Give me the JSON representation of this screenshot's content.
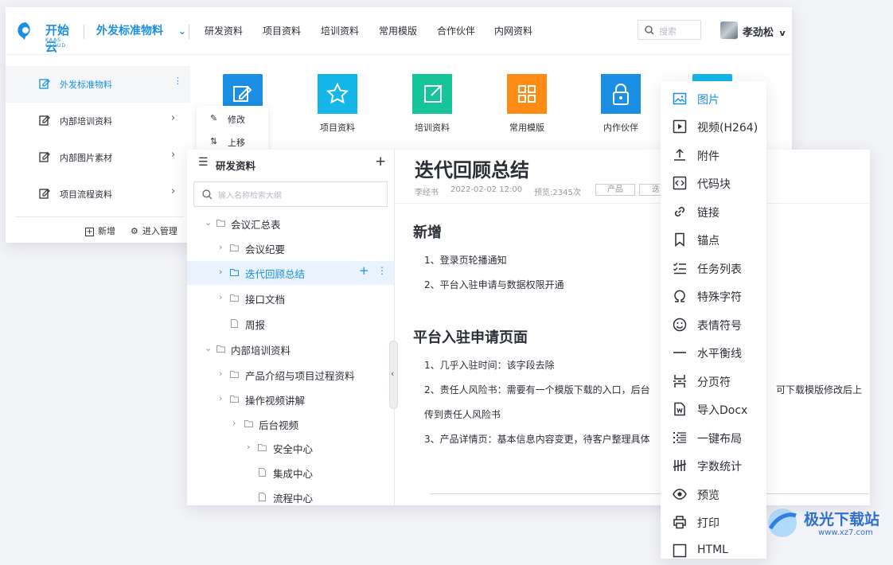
{
  "header": {
    "logo_text": "开始云",
    "logo_sub": "KAAS CLOUD",
    "space_selector": "外发标准物料",
    "nav": [
      "研发资料",
      "项目资料",
      "培训资料",
      "常用模版",
      "合作伙伴",
      "内网资料"
    ],
    "search_placeholder": "搜索",
    "user_name": "孝劲松"
  },
  "sidebar": {
    "items": [
      {
        "label": "外发标准物料",
        "active": true
      },
      {
        "label": "内部培训资料"
      },
      {
        "label": "内部图片素材"
      },
      {
        "label": "项目流程资料"
      }
    ],
    "add_label": "新增",
    "manage_label": "进入管理"
  },
  "context_menu": {
    "edit": "修改",
    "move_up": "上移"
  },
  "tiles": [
    {
      "label": "项目资料",
      "color": "#14b6e8"
    },
    {
      "label": "培训资料",
      "color": "#16c49a"
    },
    {
      "label": "常用模版",
      "color": "#ff8a14"
    },
    {
      "label": "内作伙伴",
      "color": "#1a8fe3"
    }
  ],
  "tree": {
    "title": "研发资料",
    "add": "+",
    "search_placeholder": "输入名称检索大纲",
    "nodes": [
      {
        "label": "会议汇总表"
      },
      {
        "label": "会议纪要"
      },
      {
        "label": "迭代回顾总结",
        "selected": true
      },
      {
        "label": "接口文档"
      },
      {
        "label": "周报"
      },
      {
        "label": "内部培训资料"
      },
      {
        "label": "产品介绍与项目过程资料"
      },
      {
        "label": "操作视频讲解"
      },
      {
        "label": "后台视频"
      },
      {
        "label": "安全中心"
      },
      {
        "label": "集成中心"
      },
      {
        "label": "流程中心"
      }
    ]
  },
  "doc": {
    "title": "迭代回顾总结",
    "author": "李经书",
    "date": "2022-02-02 12:00",
    "views": "预览:2345次",
    "tag1": "产品",
    "tag2": "迭",
    "section1": "新增",
    "s1_items": [
      "1、登录页轮播通知",
      "2、平台入驻申请与数据权限开通"
    ],
    "section2": "平台入驻申请页面",
    "s2_items": [
      "1、几乎入驻时间：该字段去除",
      "2、责任人风险书：需要有一个模版下载的入口，后台",
      "可下载模版修改后上",
      "传到责任人风险书",
      "3、产品详情页：基本信息内容变更，待客户整理具体"
    ]
  },
  "insert_menu": {
    "items": [
      "图片",
      "视频(H264)",
      "附件",
      "代码块",
      "链接",
      "锚点",
      "任务列表",
      "特殊字符",
      "表情符号",
      "水平衡线",
      "分页符",
      "导入Docx",
      "一键布局",
      "字数统计",
      "预览",
      "打印",
      "HTML"
    ],
    "active_index": 0
  },
  "watermark": {
    "text": "极光下载站",
    "url": "www.xz7.com"
  },
  "colors": {
    "accent": "#1a8fe3",
    "selected_bg": "#e8f3fd"
  }
}
